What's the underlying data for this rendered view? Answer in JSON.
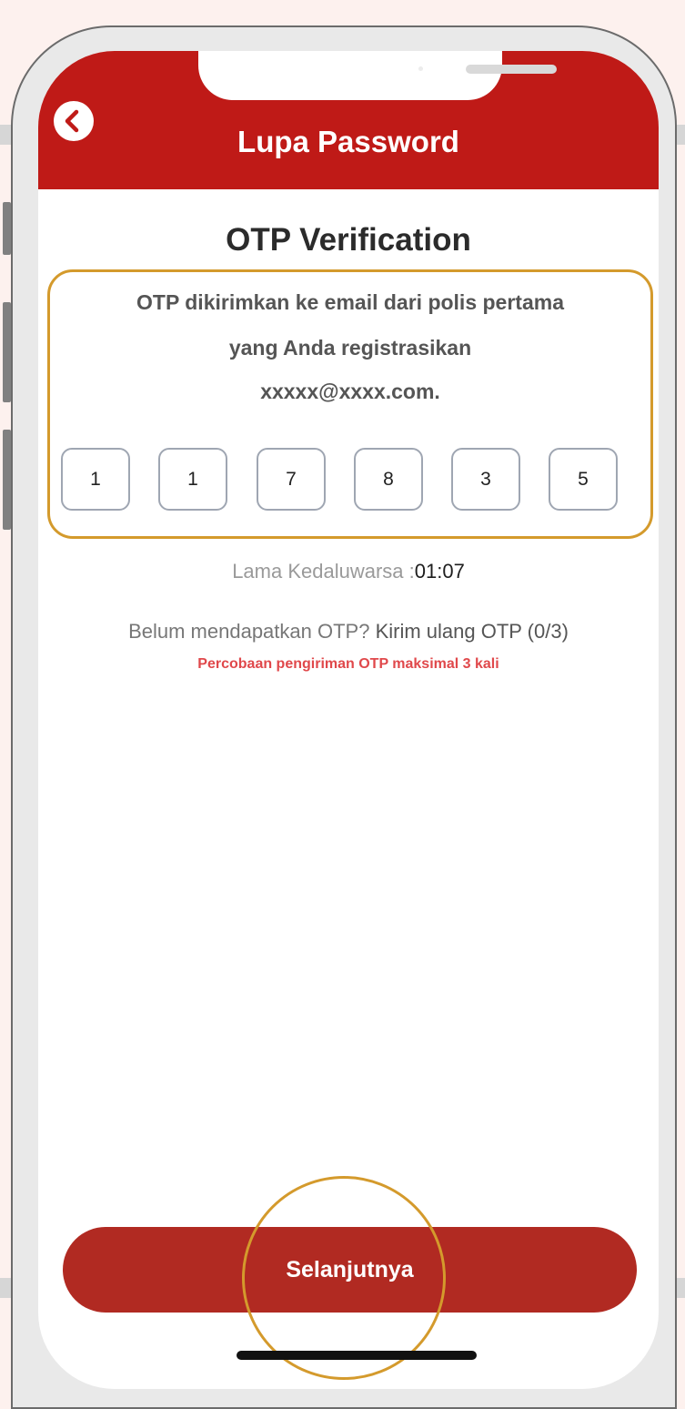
{
  "header": {
    "title": "Lupa Password",
    "background_color": "#bf1a17"
  },
  "main": {
    "title": "OTP Verification",
    "message_lines": [
      "OTP dikirimkan ke email dari polis pertama",
      "yang Anda registrasikan",
      "xxxxx@xxxx.com."
    ],
    "otp_digits": [
      "1",
      "1",
      "7",
      "8",
      "3",
      "5"
    ],
    "expiry_label": "Lama Kedaluwarsa :",
    "expiry_time": "01:07",
    "resend_question": "Belum mendapatkan OTP?",
    "resend_link": "Kirim ulang OTP (0/3)",
    "resend_warning": "Percobaan pengiriman OTP maksimal 3 kali"
  },
  "footer": {
    "next_button_label": "Selanjutnya",
    "button_color": "#b12a22"
  },
  "annotations": {
    "highlight_color": "#d49a2c"
  },
  "icons": {
    "back": "chevron-left-icon"
  }
}
